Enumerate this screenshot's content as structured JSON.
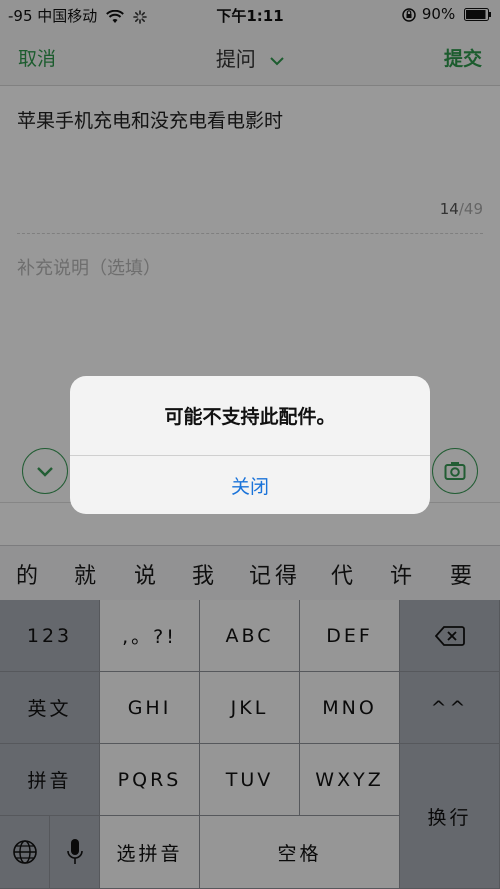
{
  "status_bar": {
    "carrier": "-95 中国移动",
    "time": "下午1:11",
    "battery": "90%",
    "icons": [
      "wifi-icon",
      "loading-icon",
      "orientation-lock-icon",
      "battery-icon"
    ]
  },
  "nav": {
    "cancel": "取消",
    "title": "提问",
    "submit": "提交"
  },
  "question": {
    "text": "苹果手机充电和没充电看电影时",
    "count": "14",
    "max": "/49"
  },
  "supplement": {
    "placeholder": "补充说明（选填）"
  },
  "toolbar": {
    "icons": [
      "chevron-down-circle-icon",
      "camera-icon"
    ]
  },
  "candidates": [
    "的",
    "就",
    "说",
    "我",
    "记得",
    "代",
    "许",
    "要"
  ],
  "keyboard": {
    "rows": [
      [
        "123",
        ",。?!",
        "ABC",
        "DEF",
        "delete-icon"
      ],
      [
        "英文",
        "GHI",
        "JKL",
        "MNO",
        "^^"
      ],
      [
        "拼音",
        "PQRS",
        "TUV",
        "WXYZ",
        "换行"
      ],
      [
        "globe-icon",
        "microphone-icon",
        "选拼音",
        "空格"
      ]
    ],
    "key_123": "123",
    "key_punct": ",。?!",
    "key_abc": "ABC",
    "key_def": "DEF",
    "key_english": "英文",
    "key_ghi": "GHI",
    "key_jkl": "JKL",
    "key_mno": "MNO",
    "key_emoticon": "^^",
    "key_pinyin": "拼音",
    "key_pqrs": "PQRS",
    "key_tuv": "TUV",
    "key_wxyz": "WXYZ",
    "key_return": "换行",
    "key_select_pinyin": "选拼音",
    "key_space": "空格"
  },
  "alert": {
    "message": "可能不支持此配件。",
    "button": "关闭"
  },
  "colors": {
    "accent_green": "#2f9a4e",
    "alert_button_blue": "#1a73d9"
  }
}
